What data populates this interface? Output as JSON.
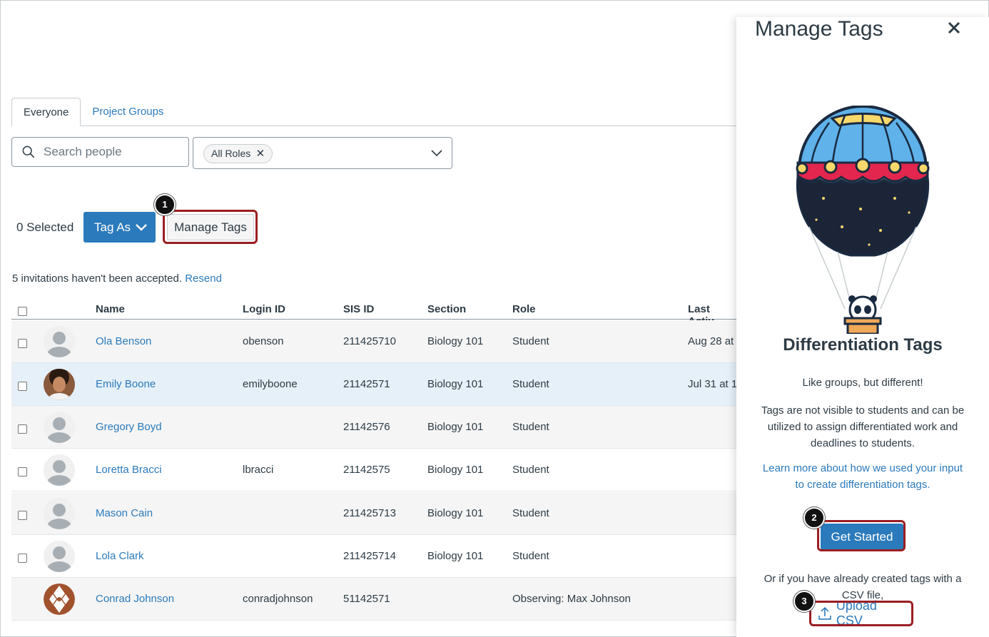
{
  "tabs": [
    {
      "label": "Everyone"
    },
    {
      "label": "Project Groups"
    }
  ],
  "search": {
    "placeholder": "Search people"
  },
  "roles_filter": {
    "chip": "All Roles"
  },
  "actions": {
    "selected_count": "0 Selected",
    "tag_as": "Tag As",
    "manage_tags": "Manage Tags"
  },
  "invites": {
    "text": "5 invitations haven't been accepted.",
    "resend": "Resend"
  },
  "table": {
    "headers": [
      "Name",
      "Login ID",
      "SIS ID",
      "Section",
      "Role",
      "Last Activ"
    ],
    "rows": [
      {
        "name": "Ola Benson",
        "login": "obenson",
        "sis": "211425710",
        "section": "Biology 101",
        "role": "Student",
        "last": "Aug 28 at"
      },
      {
        "name": "Emily Boone",
        "login": "emilyboone",
        "sis": "21142571",
        "section": "Biology 101",
        "role": "Student",
        "last": "Jul 31 at 1"
      },
      {
        "name": "Gregory Boyd",
        "login": "",
        "sis": "21142576",
        "section": "Biology 101",
        "role": "Student",
        "last": ""
      },
      {
        "name": "Loretta Bracci",
        "login": "lbracci",
        "sis": "21142575",
        "section": "Biology 101",
        "role": "Student",
        "last": ""
      },
      {
        "name": "Mason Cain",
        "login": "",
        "sis": "211425713",
        "section": "Biology 101",
        "role": "Student",
        "last": ""
      },
      {
        "name": "Lola Clark",
        "login": "",
        "sis": "211425714",
        "section": "Biology 101",
        "role": "Student",
        "last": ""
      },
      {
        "name": "Conrad Johnson",
        "login": "conradjohnson",
        "sis": "51142571",
        "section": "",
        "role": "Observing: Max Johnson",
        "last": ""
      }
    ]
  },
  "panel": {
    "title": "Manage Tags",
    "heading": "Differentiation Tags",
    "tagline": "Like groups, but different!",
    "description": "Tags are not visible to students and can be utilized to assign differentiated work and deadlines to students.",
    "learn_more": "Learn more about how we used your input to create differentiation tags.",
    "get_started": "Get Started",
    "csv_note": "Or if you have already created tags with a CSV file,",
    "upload_csv": "Upload CSV"
  },
  "callouts": [
    "1",
    "2",
    "3"
  ],
  "colors": {
    "accent": "#2b7abc",
    "highlight": "#9a1e23",
    "text": "#2d3b45"
  },
  "icons": [
    "search-icon",
    "close-icon",
    "chevron-down-icon",
    "upload-icon",
    "avatar-placeholder-icon"
  ]
}
